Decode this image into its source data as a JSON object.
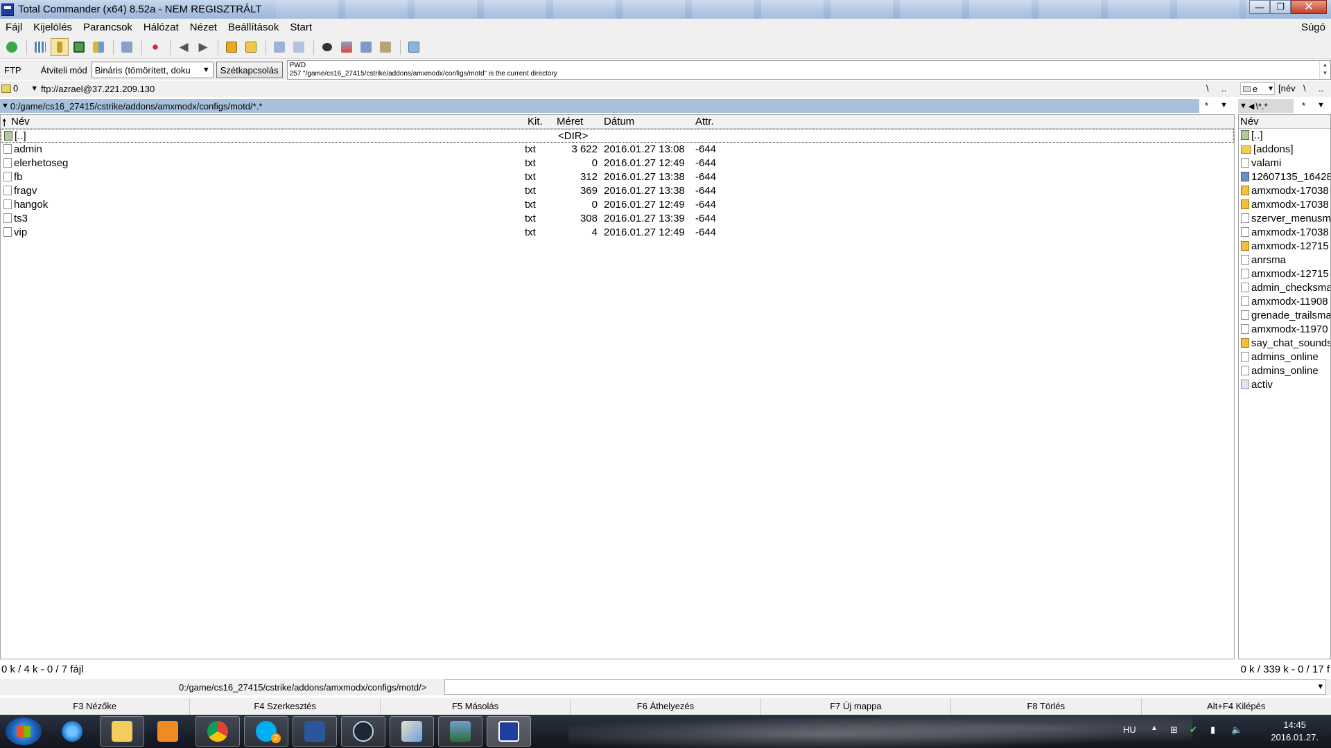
{
  "window": {
    "title": "Total Commander (x64) 8.52a - NEM REGISZTRÁLT",
    "buttons": {
      "minimize": "—",
      "maximize": "❐",
      "close": "✕"
    }
  },
  "menu": {
    "items": [
      "Fájl",
      "Kijelölés",
      "Parancsok",
      "Hálózat",
      "Nézet",
      "Beállítások",
      "Start"
    ],
    "help": "Súgó"
  },
  "toolbar": {
    "icons": [
      "refresh-icon",
      "brief-view-icon",
      "tree-view-icon",
      "thumbnails-icon",
      "compare-icon",
      "sync-icon",
      "invert-selection-icon",
      "back-icon",
      "forward-icon",
      "pack-icon",
      "unpack-icon",
      "ftp-connect-icon",
      "url-connect-icon",
      "find-icon",
      "multi-rename-icon",
      "compare-dirs-icon",
      "sync-dirs-icon",
      "notepad-icon"
    ]
  },
  "ftp": {
    "label": "FTP",
    "transfer_mode_label": "Átviteli mód",
    "transfer_mode_value": "Bináris (tömörített, doku",
    "disconnect_label": "Szétkapcsolás",
    "log_line1": "PWD",
    "log_line2": "257 \"/game/cs16_27415/cstrike/addons/amxmodx/configs/motd\" is the current directory"
  },
  "left_panel": {
    "drive": "0",
    "address": "ftp://azrael@37.221.209.130",
    "root_btn": "\\",
    "up_btn": "..",
    "path": "0:/game/cs16_27415/cstrike/addons/amxmodx/configs/motd/*.*",
    "star_btn": "*",
    "columns": {
      "name": "Név",
      "ext": "Kit.",
      "size": "Méret",
      "date": "Dátum",
      "attr": "Attr."
    },
    "parent": {
      "name": "[..]",
      "size": "<DIR>"
    },
    "files": [
      {
        "name": "admin",
        "ext": "txt",
        "size": "3 622",
        "date": "2016.01.27 13:08",
        "attr": "-644"
      },
      {
        "name": "elerhetoseg",
        "ext": "txt",
        "size": "0",
        "date": "2016.01.27 12:49",
        "attr": "-644"
      },
      {
        "name": "fb",
        "ext": "txt",
        "size": "312",
        "date": "2016.01.27 13:38",
        "attr": "-644"
      },
      {
        "name": "fragv",
        "ext": "txt",
        "size": "369",
        "date": "2016.01.27 13:38",
        "attr": "-644"
      },
      {
        "name": "hangok",
        "ext": "txt",
        "size": "0",
        "date": "2016.01.27 12:49",
        "attr": "-644"
      },
      {
        "name": "ts3",
        "ext": "txt",
        "size": "308",
        "date": "2016.01.27 13:39",
        "attr": "-644"
      },
      {
        "name": "vip",
        "ext": "txt",
        "size": "4",
        "date": "2016.01.27 12:49",
        "attr": "-644"
      }
    ],
    "status": "0 k / 4 k - 0 / 7 fájl"
  },
  "right_panel": {
    "drive": "e",
    "volume": "[név",
    "root_btn": "\\",
    "up_btn": "..",
    "path": "\\*.*",
    "star_btn": "*",
    "column_name": "Név",
    "items": [
      {
        "name": "[..]",
        "type": "up"
      },
      {
        "name": "[addons]",
        "type": "folder"
      },
      {
        "name": "valami",
        "type": "file"
      },
      {
        "name": "12607135_16428",
        "type": "img"
      },
      {
        "name": "amxmodx-17038",
        "type": "zip"
      },
      {
        "name": "amxmodx-17038",
        "type": "zip"
      },
      {
        "name": "szerver_menusm",
        "type": "file"
      },
      {
        "name": "amxmodx-17038",
        "type": "file"
      },
      {
        "name": "amxmodx-12715",
        "type": "zip"
      },
      {
        "name": "anrsma",
        "type": "file"
      },
      {
        "name": "amxmodx-12715",
        "type": "file"
      },
      {
        "name": "admin_checksma",
        "type": "file"
      },
      {
        "name": "amxmodx-11908",
        "type": "file"
      },
      {
        "name": "grenade_trailsma",
        "type": "file"
      },
      {
        "name": "amxmodx-11970",
        "type": "file"
      },
      {
        "name": "say_chat_sounds",
        "type": "zip"
      },
      {
        "name": "admins_online",
        "type": "file"
      },
      {
        "name": "admins_online",
        "type": "file"
      },
      {
        "name": "activ",
        "type": "exe"
      }
    ],
    "status": "0 k / 339 k - 0 / 17 f"
  },
  "command_line": {
    "path": "0:/game/cs16_27415/cstrike/addons/amxmodx/configs/motd/>",
    "value": ""
  },
  "function_keys": [
    "F3 Nézőke",
    "F4 Szerkesztés",
    "F5 Másolás",
    "F6 Áthelyezés",
    "F7 Új mappa",
    "F8 Törlés",
    "Alt+F4 Kilépés"
  ],
  "taskbar": {
    "apps": [
      "internet-explorer-icon",
      "file-explorer-icon",
      "media-player-icon",
      "chrome-icon",
      "skype-icon",
      "word-icon",
      "steam-icon",
      "paint-icon",
      "photo-viewer-icon",
      "total-commander-icon"
    ],
    "skype_badge": "2",
    "language": "HU",
    "time": "14:45",
    "date": "2016.01.27."
  },
  "colors": {
    "path_active": "#a7c1dc",
    "taskbar": "#1a1f2a",
    "selection_toolbar": "#f5e6a8"
  }
}
